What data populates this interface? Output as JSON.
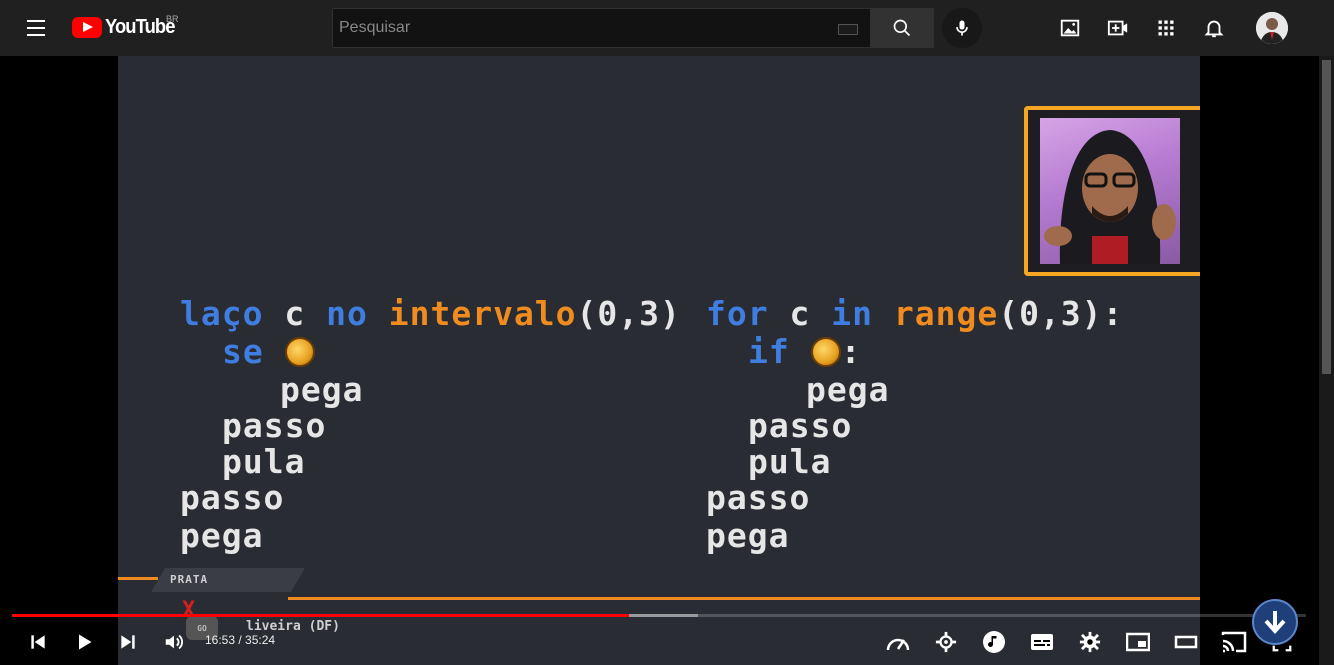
{
  "header": {
    "logo_text": "YouTube",
    "country": "BR",
    "search_placeholder": "Pesquisar",
    "search_value": ""
  },
  "video": {
    "left_code": {
      "line1": {
        "kw1": "laço",
        "var": "c",
        "kw2": "no",
        "fn": "intervalo",
        "args": "(0,3)"
      },
      "line2": {
        "kw": "se"
      },
      "line3": "pega",
      "line4": "passo",
      "line5": "pula",
      "line6": "passo",
      "line7": "pega"
    },
    "right_code": {
      "line1": {
        "kw1": "for",
        "var": "c",
        "kw2": "in",
        "fn": "range",
        "args": "(0,3)",
        "colon": ":"
      },
      "line2": {
        "kw": "if",
        "colon": ":"
      },
      "line3": "pega",
      "line4": "passo",
      "line5": "pula",
      "line6": "passo",
      "line7": "pega"
    },
    "badge_label": "PRATA",
    "overlay_name": "liveira (DF)",
    "go_label": "GO",
    "x_mark": "X"
  },
  "player": {
    "current_time": "16:53",
    "duration": "35:24",
    "time_display": "16:53 / 35:24",
    "progress_fraction": 0.4768,
    "buffered_fraction": 0.53
  },
  "colors": {
    "keyword": "#3f7de0",
    "function": "#f08b1f",
    "played": "#ff0000",
    "accent_frame": "#f5a623"
  }
}
